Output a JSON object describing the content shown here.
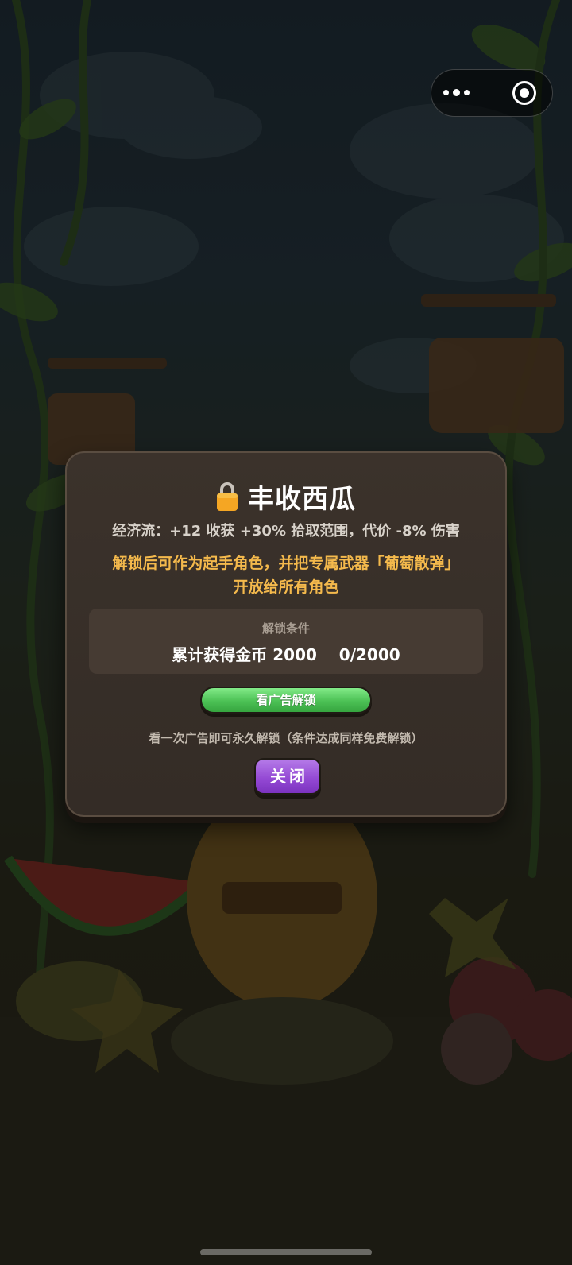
{
  "capsule": {
    "more_icon": "more-dots-icon",
    "close_icon": "target-circle-icon"
  },
  "dialog": {
    "lock_icon": "lock-icon",
    "title": "丰收西瓜",
    "stats": "经济流：+12 收获 +30% 拾取范围，代价 -8% 伤害",
    "unlock_desc_line1": "解锁后可作为起手角色，并把专属武器「葡萄散弹」",
    "unlock_desc_line2": "开放给所有角色",
    "condition": {
      "label": "解锁条件",
      "requirement": "累计获得金币 2000",
      "progress": "0/2000"
    },
    "ad_button_label": "看广告解锁",
    "ad_hint": "看一次广告即可永久解锁（条件达成同样免费解锁）",
    "close_button_label": "关闭"
  },
  "colors": {
    "accent_text": "#f4b94c",
    "ad_button": "#4cc155",
    "close_button": "#9247d3",
    "panel": "#3b322b",
    "lock": "#f5a623"
  }
}
